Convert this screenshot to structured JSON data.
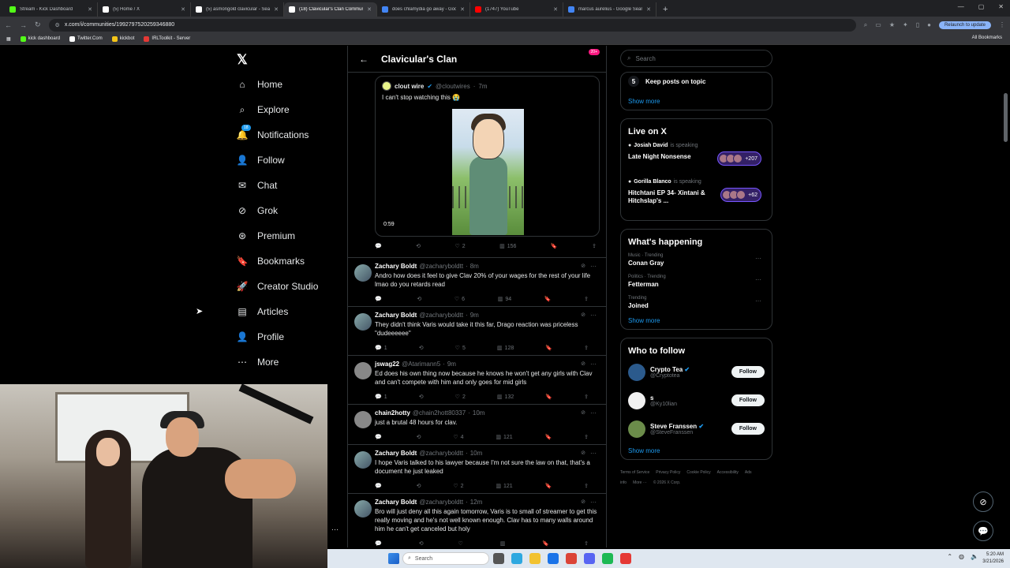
{
  "browser": {
    "tabs": [
      {
        "title": "Stream - Kick Dashboard",
        "color": "#53fc18",
        "active": false
      },
      {
        "title": "(5) Home / X",
        "color": "#ffffff",
        "active": false
      },
      {
        "title": "(5) asmongold clavicular - Sear",
        "color": "#ffffff",
        "active": false
      },
      {
        "title": "(18) Clavicular's Clan Communi",
        "color": "#ffffff",
        "active": true
      },
      {
        "title": "does chlamydia go away - Goo",
        "color": "#4285f4",
        "active": false
      },
      {
        "title": "(1747) YouTube",
        "color": "#ff0000",
        "active": false
      },
      {
        "title": "marcus aurelius - Google Searc",
        "color": "#4285f4",
        "active": false
      }
    ],
    "url": "x.com/i/communities/1992797520259346880",
    "relaunch_label": "Relaunch to update",
    "bookmarks": [
      {
        "label": "kick dashboard",
        "color": "#53fc18"
      },
      {
        "label": "Twitter.Com",
        "color": "#ffffff"
      },
      {
        "label": "kickbot",
        "color": "#f5c518"
      },
      {
        "label": "IRLToolkit - Server",
        "color": "#e53935"
      }
    ],
    "all_bookmarks_label": "All Bookmarks"
  },
  "nav": {
    "items": [
      {
        "label": "Home",
        "icon": "home-icon"
      },
      {
        "label": "Explore",
        "icon": "search-icon"
      },
      {
        "label": "Notifications",
        "icon": "bell-icon",
        "badge": "18"
      },
      {
        "label": "Follow",
        "icon": "person-plus-icon"
      },
      {
        "label": "Chat",
        "icon": "mail-icon"
      },
      {
        "label": "Grok",
        "icon": "grok-icon"
      },
      {
        "label": "Premium",
        "icon": "premium-icon"
      },
      {
        "label": "Bookmarks",
        "icon": "bookmark-icon"
      },
      {
        "label": "Creator Studio",
        "icon": "rocket-icon"
      },
      {
        "label": "Articles",
        "icon": "article-icon"
      },
      {
        "label": "Profile",
        "icon": "person-icon"
      },
      {
        "label": "More",
        "icon": "more-icon"
      }
    ]
  },
  "community": {
    "title": "Clavicular's Clan",
    "badge": "20+"
  },
  "quote": {
    "name": "clout wire",
    "handle": "@cloutwires",
    "time": "7m",
    "text": "I can't stop watching this 😭",
    "video_time": "0:59",
    "likes": "2",
    "views": "156"
  },
  "tweets": [
    {
      "name": "Zachary Boldt",
      "handle": "@zacharyboldtt",
      "time": "8m",
      "text": "Andro how does it feel to give Clav 20% of your wages for the rest of your life lmao do you retards read",
      "replies": "",
      "likes": "6",
      "views": "94"
    },
    {
      "name": "Zachary Boldt",
      "handle": "@zacharyboldtt",
      "time": "9m",
      "text": "They didn't think Varis would take it this far, Drago reaction was priceless \"dudeeeeee\"",
      "replies": "1",
      "likes": "5",
      "views": "128"
    },
    {
      "name": "jswag22",
      "handle": "@Atarimann5",
      "time": "9m",
      "text": "Ed does his own thing now because he knows he won't get any girls with Clav and can't compete with him and only goes for mid girls",
      "replies": "1",
      "likes": "2",
      "views": "132"
    },
    {
      "name": "chain2hotty",
      "handle": "@chain2hott80337",
      "time": "10m",
      "text": "just a brutal 48 hours for clav.",
      "replies": "",
      "likes": "4",
      "views": "121"
    },
    {
      "name": "Zachary Boldt",
      "handle": "@zacharyboldtt",
      "time": "10m",
      "text": "I hope Varis talked to his lawyer because I'm not sure the law on that, that's a document he just leaked",
      "replies": "",
      "likes": "2",
      "views": "121"
    },
    {
      "name": "Zachary Boldt",
      "handle": "@zacharyboldtt",
      "time": "12m",
      "text": "Bro will just deny all this again tomorrow, Varis is to small of streamer to get this really moving and he's not well known enough. Clav has to many walls around him he can't get canceled but holy",
      "replies": "",
      "likes": "",
      "views": ""
    }
  ],
  "sidebar": {
    "search_placeholder": "Search",
    "rule": {
      "num": "5",
      "text": "Keep posts on topic"
    },
    "show_more": "Show more",
    "live_title": "Live on X",
    "spaces": [
      {
        "host": "Josiah David",
        "status": "is speaking",
        "title": "Late Night Nonsense",
        "count": "+207"
      },
      {
        "host": "Gorilla Blanco",
        "status": "is speaking",
        "title": "Hitchtani EP 34- Xintani & Hitchslap's ...",
        "count": "+62"
      }
    ],
    "happening_title": "What's happening",
    "trends": [
      {
        "cat": "Music · Trending",
        "name": "Conan Gray"
      },
      {
        "cat": "Politics · Trending",
        "name": "Fetterman"
      },
      {
        "cat": "Trending",
        "name": "Joined"
      }
    ],
    "who_title": "Who to follow",
    "who": [
      {
        "name": "Crypto Tea",
        "handle": "@Cryptotea",
        "verified": true
      },
      {
        "name": "s",
        "handle": "@Ky10lian",
        "verified": false
      },
      {
        "name": "Steve Franssen",
        "handle": "@SteveFranssen",
        "verified": true
      }
    ],
    "follow_label": "Follow",
    "footer": [
      "Terms of Service",
      "Privacy Policy",
      "Cookie Policy",
      "Accessibility",
      "Ads info",
      "More ···",
      "© 2026 X Corp."
    ]
  },
  "taskbar": {
    "search_placeholder": "Search",
    "time": "5:20 AM",
    "date": "3/21/2026"
  }
}
